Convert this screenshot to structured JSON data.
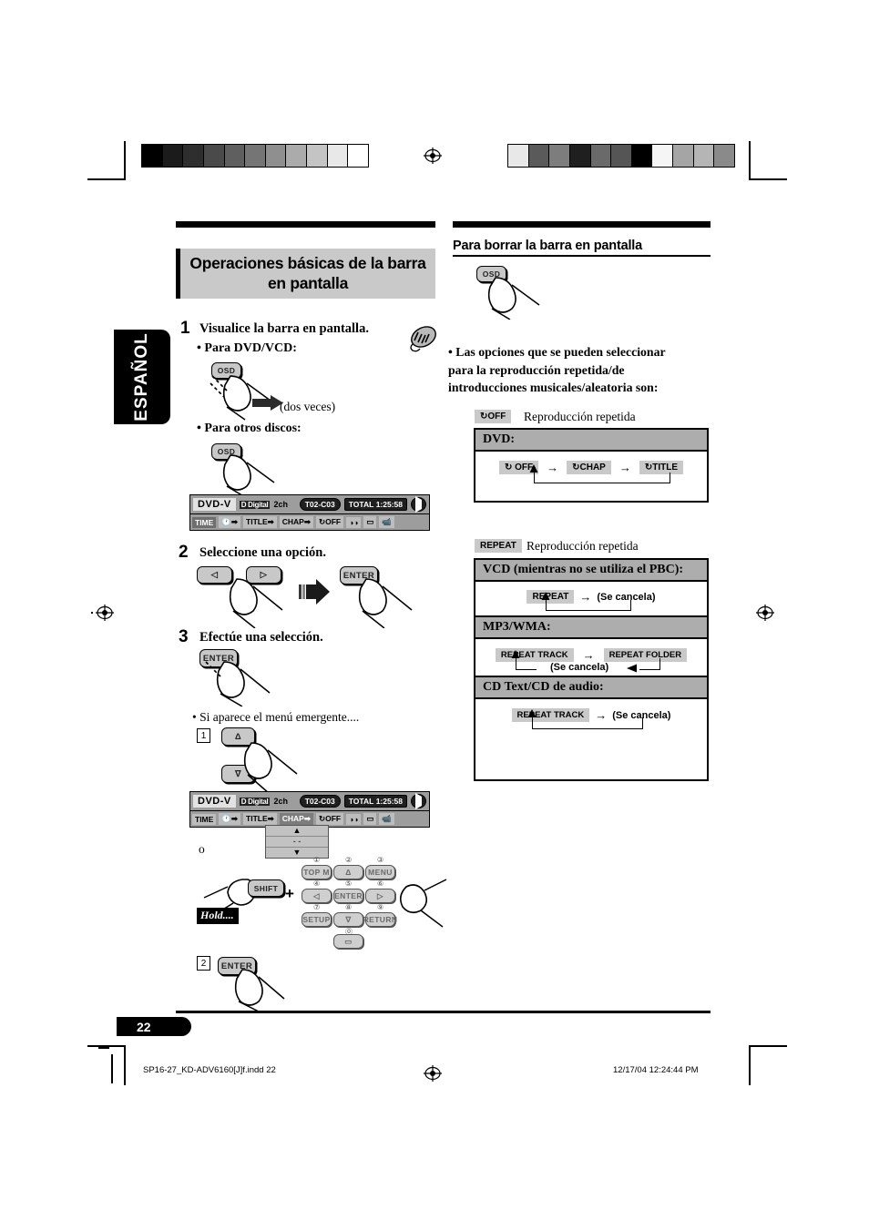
{
  "page": {
    "number": "22",
    "language_tab": "ESPAÑOL",
    "footer_file": "SP16-27_KD-ADV6160[J]f.indd   22",
    "footer_date": "12/17/04   12:24:44 PM"
  },
  "left_column": {
    "section_title": "Operaciones básicas de la barra en pantalla",
    "steps": [
      {
        "number": "1",
        "text": "Visualice la barra en pantalla.",
        "remote_icon": "remote-control-icon",
        "sub_a": "• Para DVD/VCD:",
        "key_a": "OSD",
        "note_a": "(dos veces)",
        "sub_b": "• Para otros discos:",
        "key_b": "OSD"
      },
      {
        "number": "2",
        "text": "Seleccione una opción.",
        "key_left": "◁",
        "key_right": "▷",
        "key_enter": "ENTER"
      },
      {
        "number": "3",
        "text": "Efectúe una selección.",
        "key_enter": "ENTER",
        "note": "• Si aparece el menú emergente....",
        "substep_1": "1",
        "key_up": "Δ",
        "key_down": "∇",
        "or_text": "o",
        "substep_2": "2",
        "key_enter_2": "ENTER"
      }
    ],
    "osd_bar": {
      "disc_type": "DVD-V",
      "audio_format": "D Digital",
      "channels": "2ch",
      "chapter": "T02-C03",
      "time_label": "TOTAL",
      "time_value": "1:25:58",
      "row2": [
        "TIME",
        "TITLE",
        "CHAP",
        "OFF"
      ],
      "row2_time_chip": "TIME",
      "icons": [
        "clock-icon",
        "title-arrow-icon",
        "chap-arrow-icon",
        "repeat-off-icon",
        "audio-icon",
        "subtitle-icon",
        "angle-icon"
      ]
    },
    "popup_menu": {
      "value": "- -"
    },
    "remote_keypad": {
      "shift_key": "SHIFT",
      "hold_label": "Hold....",
      "plus": "+",
      "keys": [
        {
          "num": "①",
          "label": "TOP M"
        },
        {
          "num": "②",
          "label": "Δ"
        },
        {
          "num": "③",
          "label": "MENU"
        },
        {
          "num": "④",
          "label": "◁"
        },
        {
          "num": "⑤",
          "label": "ENTER"
        },
        {
          "num": "⑥",
          "label": "▷"
        },
        {
          "num": "⑦",
          "label": "SETUP"
        },
        {
          "num": "⑧",
          "label": "∇"
        },
        {
          "num": "⑨",
          "label": "RETURN"
        },
        {
          "num": "⓪",
          "label": "▭"
        }
      ]
    }
  },
  "right_column": {
    "heading": "Para borrar la barra en pantalla",
    "key_osd": "OSD",
    "bullet": "• Las opciones que se pueden seleccionar para la reproducción repetida/de introducciones musicales/aleatoria son:",
    "group_1": {
      "tag": "OFF",
      "tag_icon": "repeat-off-icon",
      "caption": "Reproducción repetida",
      "box": {
        "header": "DVD:",
        "items": [
          "OFF",
          "CHAP",
          "TITLE"
        ],
        "arrows": [
          "→",
          "→"
        ]
      }
    },
    "group_2": {
      "tag": "REPEAT",
      "caption": "Reproducción repetida",
      "boxes": [
        {
          "header": "VCD (mientras no se utiliza el PBC):",
          "items": [
            "REPEAT"
          ],
          "cancel": "(Se cancela)",
          "arrow": "→"
        },
        {
          "header": "MP3/WMA:",
          "items": [
            "REPEAT TRACK",
            "REPEAT FOLDER"
          ],
          "cancel": "(Se cancela)",
          "arrow": "→"
        },
        {
          "header": "CD Text/CD de audio:",
          "items": [
            "REPEAT TRACK"
          ],
          "cancel": "(Se cancela)",
          "arrow": "→"
        }
      ]
    }
  }
}
